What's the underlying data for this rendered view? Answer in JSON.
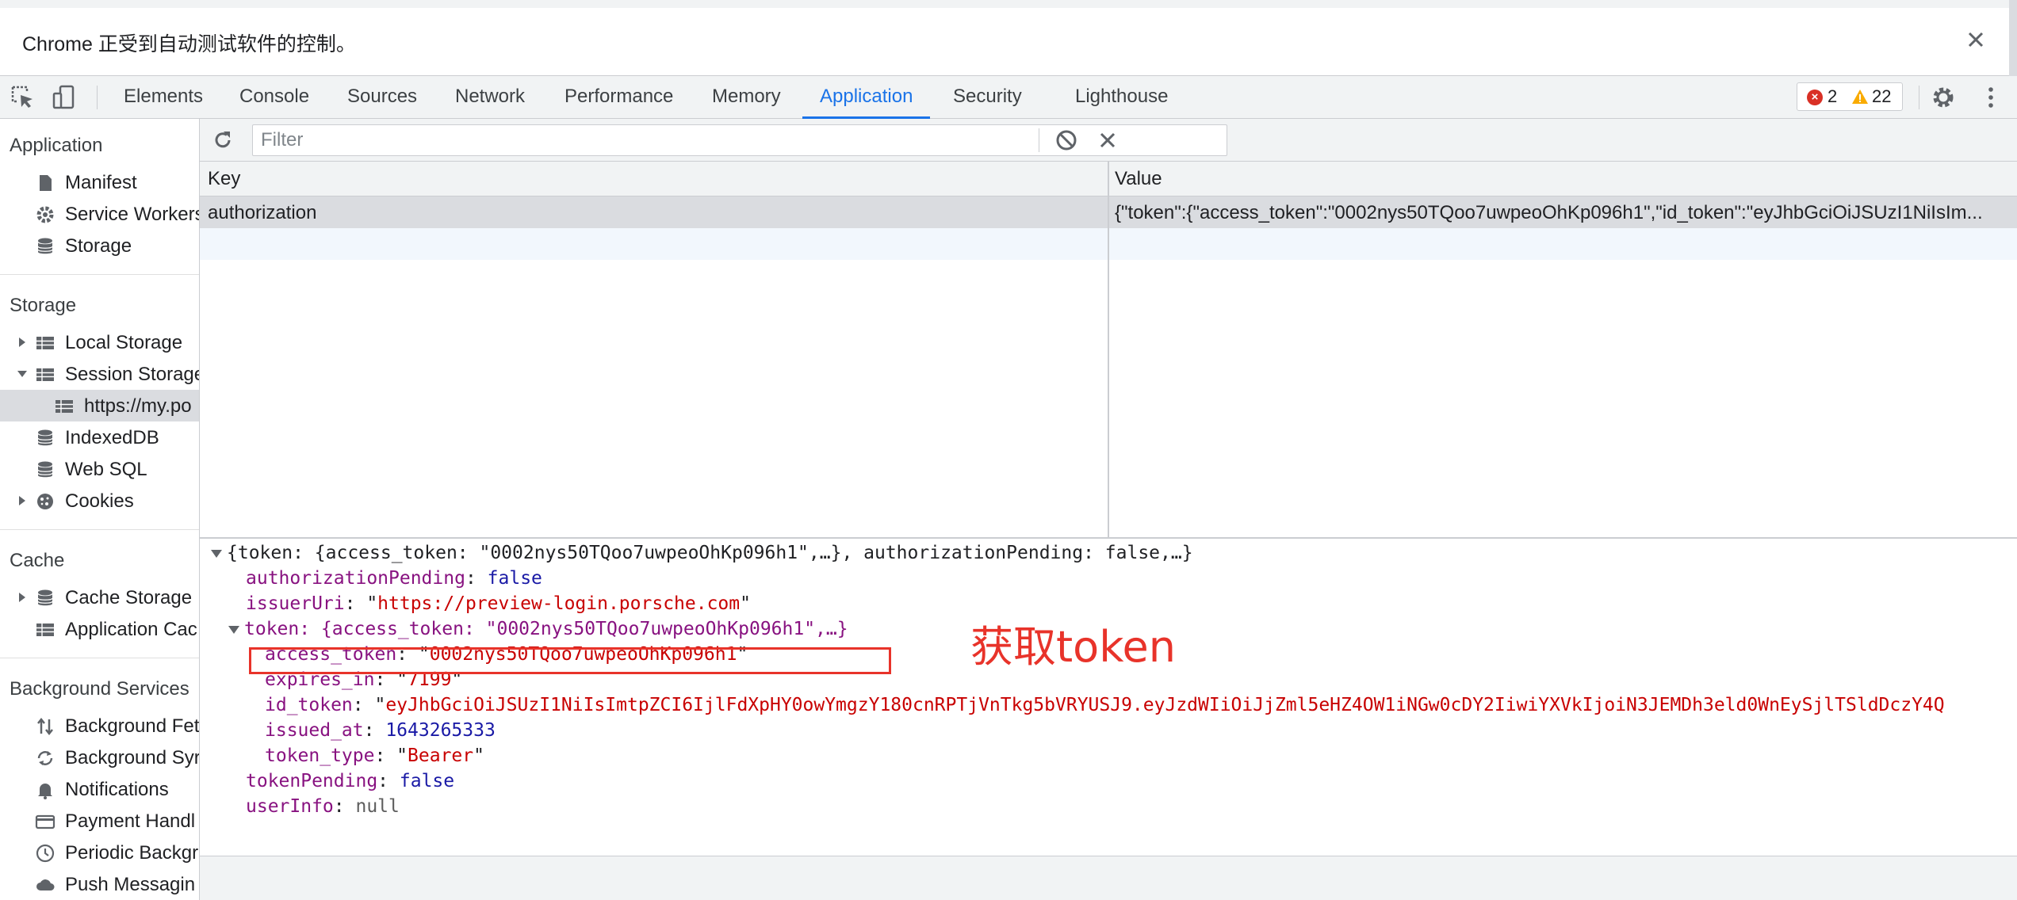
{
  "infobar": {
    "message": "Chrome 正受到自动测试软件的控制。",
    "close_icon": "close-icon"
  },
  "devtools_tabs": [
    {
      "label": "Elements"
    },
    {
      "label": "Console"
    },
    {
      "label": "Sources"
    },
    {
      "label": "Network"
    },
    {
      "label": "Performance"
    },
    {
      "label": "Memory"
    },
    {
      "label": "Application",
      "active": true
    },
    {
      "label": "Security"
    },
    {
      "label": "Lighthouse"
    }
  ],
  "issues": {
    "errors": "2",
    "warnings": "22"
  },
  "sidebar": {
    "application_header": "Application",
    "application_items": [
      {
        "label": "Manifest",
        "icon": "document-icon"
      },
      {
        "label": "Service Workers",
        "icon": "gear-icon"
      },
      {
        "label": "Storage",
        "icon": "database-icon"
      }
    ],
    "storage_header": "Storage",
    "storage_items": [
      {
        "label": "Local Storage",
        "icon": "grid-icon"
      },
      {
        "label": "Session Storage",
        "icon": "grid-icon"
      },
      {
        "label": "https://my.po",
        "icon": "grid-icon"
      },
      {
        "label": "IndexedDB",
        "icon": "database-icon"
      },
      {
        "label": "Web SQL",
        "icon": "database-icon"
      },
      {
        "label": "Cookies",
        "icon": "cookie-icon"
      }
    ],
    "cache_header": "Cache",
    "cache_items": [
      {
        "label": "Cache Storage",
        "icon": "database-icon"
      },
      {
        "label": "Application Cac",
        "icon": "grid-icon"
      }
    ],
    "background_header": "Background Services",
    "background_items": [
      {
        "label": "Background Fet",
        "icon": "arrows-icon"
      },
      {
        "label": "Background Syr",
        "icon": "sync-icon"
      },
      {
        "label": "Notifications",
        "icon": "bell-icon"
      },
      {
        "label": "Payment Handl",
        "icon": "card-icon"
      },
      {
        "label": "Periodic Backgr",
        "icon": "clock-icon"
      },
      {
        "label": "Push Messagin",
        "icon": "cloud-icon"
      }
    ]
  },
  "toolbar": {
    "filter_placeholder": "Filter"
  },
  "table": {
    "headers": {
      "key": "Key",
      "value": "Value"
    },
    "rows": [
      {
        "key": "authorization",
        "value": "{\"token\":{\"access_token\":\"0002nys50TQoo7uwpeoOhKp096h1\",\"id_token\":\"eyJhbGciOiJSUzI1NiIsIm..."
      }
    ]
  },
  "preview": {
    "root_line": "{token: {access_token: \"0002nys50TQoo7uwpeoOhKp096h1\",…}, authorizationPending: false,…}",
    "authorizationPending_key": "authorizationPending",
    "authorizationPending_val": "false",
    "issuerUri_key": "issuerUri",
    "issuerUri_val": "https://preview-login.porsche.com",
    "token_line": "token: {access_token: \"0002nys50TQoo7uwpeoOhKp096h1\",…}",
    "access_token_key": "access_token",
    "access_token_val": "0002nys50TQoo7uwpeoOhKp096h1",
    "expires_in_key": "expires_in",
    "expires_in_val": "7199",
    "id_token_key": "id_token",
    "id_token_val": "eyJhbGciOiJSUzI1NiIsImtpZCI6IjlFdXpHY0owYmgzY180cnRPTjVnTkg5bVRYUSJ9.eyJzdWIiOiJjZml5eHZ4OW1iNGw0cDY2IiwiYXVkIjoiN3JEMDh3eld0WnEySjlTSldDczY4Q",
    "issued_at_key": "issued_at",
    "issued_at_val": "1643265333",
    "token_type_key": "token_type",
    "token_type_val": "Bearer",
    "tokenPending_key": "tokenPending",
    "tokenPending_val": "false",
    "userInfo_key": "userInfo",
    "userInfo_val": "null"
  },
  "annotation": "获取token",
  "colors": {
    "accent": "#1a73e8",
    "annotation": "#e8332a",
    "error": "#d93025",
    "warning": "#f9ab00"
  }
}
